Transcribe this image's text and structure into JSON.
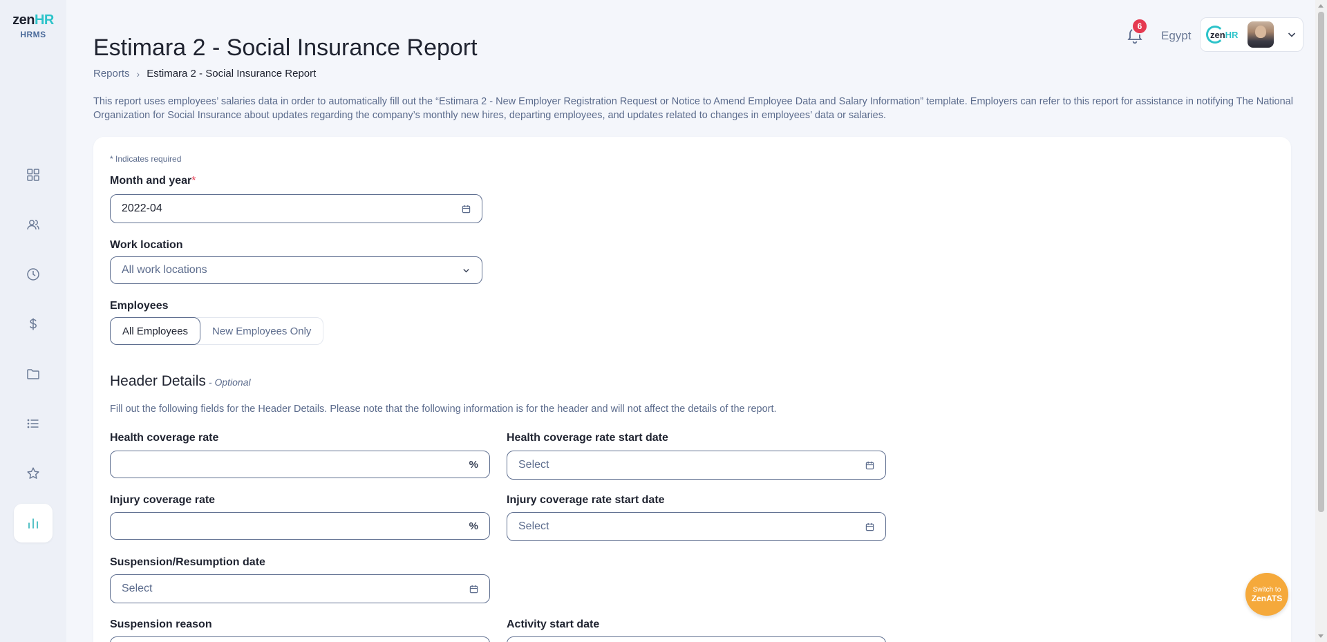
{
  "brand": {
    "name_part1": "zen",
    "name_part2": "HR",
    "product": "HRMS"
  },
  "sidebar": {
    "items": [
      {
        "icon": "dashboard-icon"
      },
      {
        "icon": "people-icon"
      },
      {
        "icon": "clock-icon"
      },
      {
        "icon": "dollar-icon"
      },
      {
        "icon": "folder-icon"
      },
      {
        "icon": "list-icon"
      },
      {
        "icon": "star-icon"
      },
      {
        "icon": "bar-chart-icon",
        "active": true
      }
    ]
  },
  "header": {
    "notification_count": "6",
    "country": "Egypt",
    "account_logo_part1": "zen",
    "account_logo_part2": "HR"
  },
  "page": {
    "title": "Estimara 2 - Social Insurance Report",
    "breadcrumb": {
      "parent": "Reports",
      "current": "Estimara 2 - Social Insurance Report"
    },
    "description": "This report uses employees’ salaries data in order to automatically fill out the “Estimara 2 - New Employer Registration Request or Notice to Amend Employee Data and Salary Information” template. Employers can refer to this report for assistance in notifying The National Organization for Social Insurance about updates regarding the company’s monthly new hires, departing employees, and updates related to changes in employees’ data or salaries."
  },
  "form": {
    "required_note": "* Indicates required",
    "month_year": {
      "label": "Month and year",
      "required_mark": "*",
      "value": "2022-04"
    },
    "work_location": {
      "label": "Work location",
      "value": "All work locations"
    },
    "employees": {
      "label": "Employees",
      "options": [
        "All Employees",
        "New Employees Only"
      ],
      "selected": "All Employees"
    },
    "header_details": {
      "title": "Header Details",
      "optional": "- Optional",
      "description": "Fill out the following fields for the Header Details. Please note that the following information is for the header and will not affect the details of the report.",
      "health_rate": {
        "label": "Health coverage rate",
        "value": "",
        "suffix": "%"
      },
      "health_start": {
        "label": "Health coverage rate start date",
        "placeholder": "Select"
      },
      "injury_rate": {
        "label": "Injury coverage rate",
        "value": "",
        "suffix": "%"
      },
      "injury_start": {
        "label": "Injury coverage rate start date",
        "placeholder": "Select"
      },
      "suspension_date": {
        "label": "Suspension/Resumption date",
        "placeholder": "Select"
      },
      "suspension_reason": {
        "label": "Suspension reason"
      },
      "activity_start": {
        "label": "Activity start date"
      }
    }
  },
  "fab": {
    "line1": "Switch to",
    "line2": "ZenATS"
  },
  "colors": {
    "accent": "#2cc3c9",
    "badge": "#e53950",
    "fab": "#f5a93b"
  }
}
